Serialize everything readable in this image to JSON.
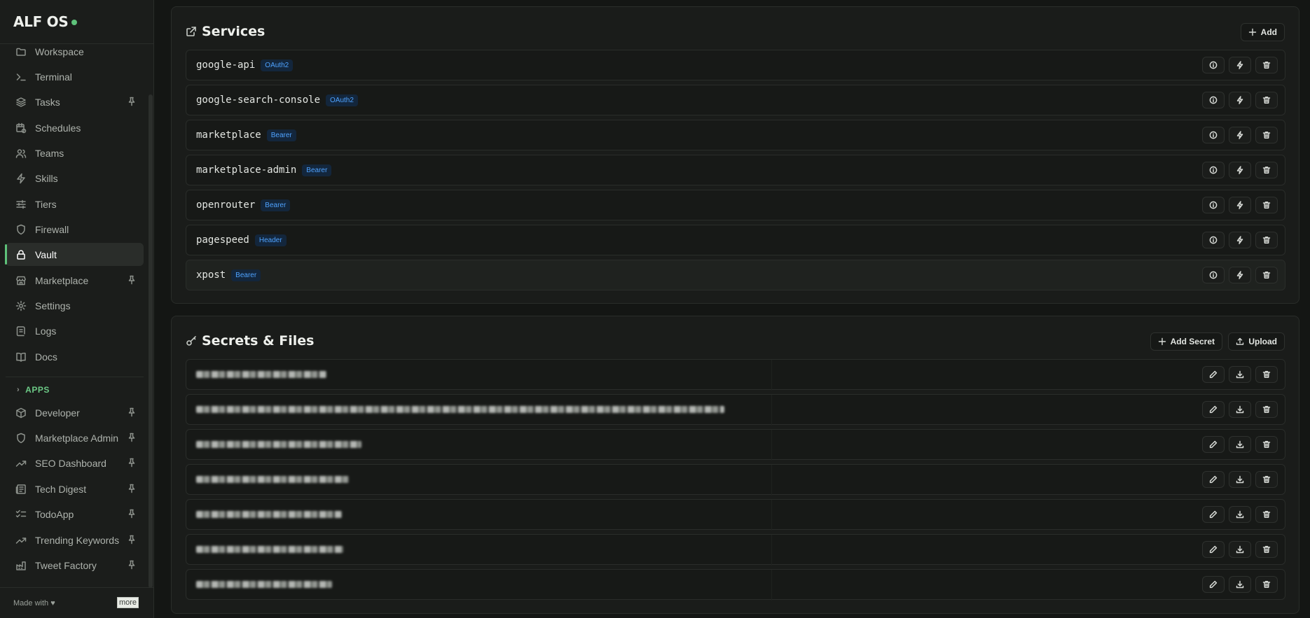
{
  "app": {
    "title": "ALF OS"
  },
  "sidebar": {
    "items": [
      {
        "label": "Workspace",
        "icon": "folder-icon",
        "pinned": false,
        "active": false
      },
      {
        "label": "Terminal",
        "icon": "terminal-icon",
        "pinned": false,
        "active": false
      },
      {
        "label": "Tasks",
        "icon": "layers-icon",
        "pinned": true,
        "active": false
      },
      {
        "label": "Schedules",
        "icon": "calendar-clock-icon",
        "pinned": false,
        "active": false
      },
      {
        "label": "Teams",
        "icon": "users-icon",
        "pinned": false,
        "active": false
      },
      {
        "label": "Skills",
        "icon": "zap-icon",
        "pinned": false,
        "active": false
      },
      {
        "label": "Tiers",
        "icon": "sliders-icon",
        "pinned": false,
        "active": false
      },
      {
        "label": "Firewall",
        "icon": "shield-icon",
        "pinned": false,
        "active": false
      },
      {
        "label": "Vault",
        "icon": "lock-icon",
        "pinned": false,
        "active": true
      },
      {
        "label": "Marketplace",
        "icon": "store-icon",
        "pinned": true,
        "active": false
      },
      {
        "label": "Settings",
        "icon": "gear-icon",
        "pinned": false,
        "active": false
      },
      {
        "label": "Logs",
        "icon": "scroll-icon",
        "pinned": false,
        "active": false
      },
      {
        "label": "Docs",
        "icon": "book-icon",
        "pinned": false,
        "active": false
      }
    ],
    "apps_label": "APPS",
    "apps": [
      {
        "label": "Developer",
        "icon": "package-icon",
        "pinned": true
      },
      {
        "label": "Marketplace Admin",
        "icon": "shield-icon",
        "pinned": true
      },
      {
        "label": "SEO Dashboard",
        "icon": "trending-up-icon",
        "pinned": true
      },
      {
        "label": "Tech Digest",
        "icon": "newspaper-icon",
        "pinned": true
      },
      {
        "label": "TodoApp",
        "icon": "list-checks-icon",
        "pinned": true
      },
      {
        "label": "Trending Keywords",
        "icon": "trending-up-icon",
        "pinned": true
      },
      {
        "label": "Tweet Factory",
        "icon": "factory-icon",
        "pinned": true
      }
    ],
    "footer": {
      "text": "Made with ♥",
      "more": "more"
    }
  },
  "services": {
    "title": "Services",
    "add_label": "Add",
    "rows": [
      {
        "name": "google-api",
        "badge": "OAuth2"
      },
      {
        "name": "google-search-console",
        "badge": "OAuth2"
      },
      {
        "name": "marketplace",
        "badge": "Bearer"
      },
      {
        "name": "marketplace-admin",
        "badge": "Bearer"
      },
      {
        "name": "openrouter",
        "badge": "Bearer"
      },
      {
        "name": "pagespeed",
        "badge": "Header"
      },
      {
        "name": "xpost",
        "badge": "Bearer"
      }
    ]
  },
  "secrets": {
    "title": "Secrets & Files",
    "add_secret_label": "Add Secret",
    "upload_label": "Upload"
  },
  "colors": {
    "accent": "#5ec27a",
    "badge": "#4fa3ff"
  }
}
